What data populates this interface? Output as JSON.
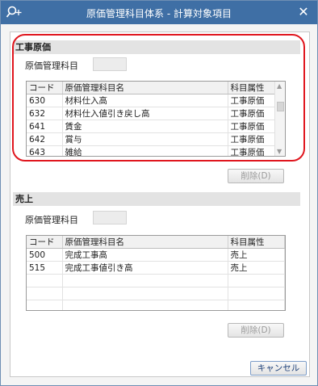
{
  "window": {
    "title": "原価管理科目体系 - 計算対象項目",
    "app_icon": "search-plus-icon",
    "close_icon": "close-icon"
  },
  "section1": {
    "header": "工事原価",
    "field_label": "原価管理科目",
    "columns": [
      "コード",
      "原価管理科目名",
      "科目属性"
    ],
    "rows": [
      [
        "630",
        "材料仕入高",
        "工事原価"
      ],
      [
        "632",
        "材料仕入値引き戻し高",
        "工事原価"
      ],
      [
        "641",
        "賃金",
        "工事原価"
      ],
      [
        "642",
        "賞与",
        "工事原価"
      ],
      [
        "643",
        "雑給",
        "工事原価"
      ]
    ],
    "delete_button": "削除(D)"
  },
  "section2": {
    "header": "売上",
    "field_label": "原価管理科目",
    "columns": [
      "コード",
      "原価管理科目名",
      "科目属性"
    ],
    "rows": [
      [
        "500",
        "完成工事高",
        "売上"
      ],
      [
        "515",
        "完成工事値引き高",
        "売上"
      ],
      [
        "",
        "",
        ""
      ],
      [
        "",
        "",
        ""
      ],
      [
        "",
        "",
        ""
      ]
    ],
    "delete_button": "削除(D)"
  },
  "cancel_button": "キャンセル",
  "colors": {
    "titlebar": "#3f6fa5",
    "highlight": "#e0161e"
  }
}
